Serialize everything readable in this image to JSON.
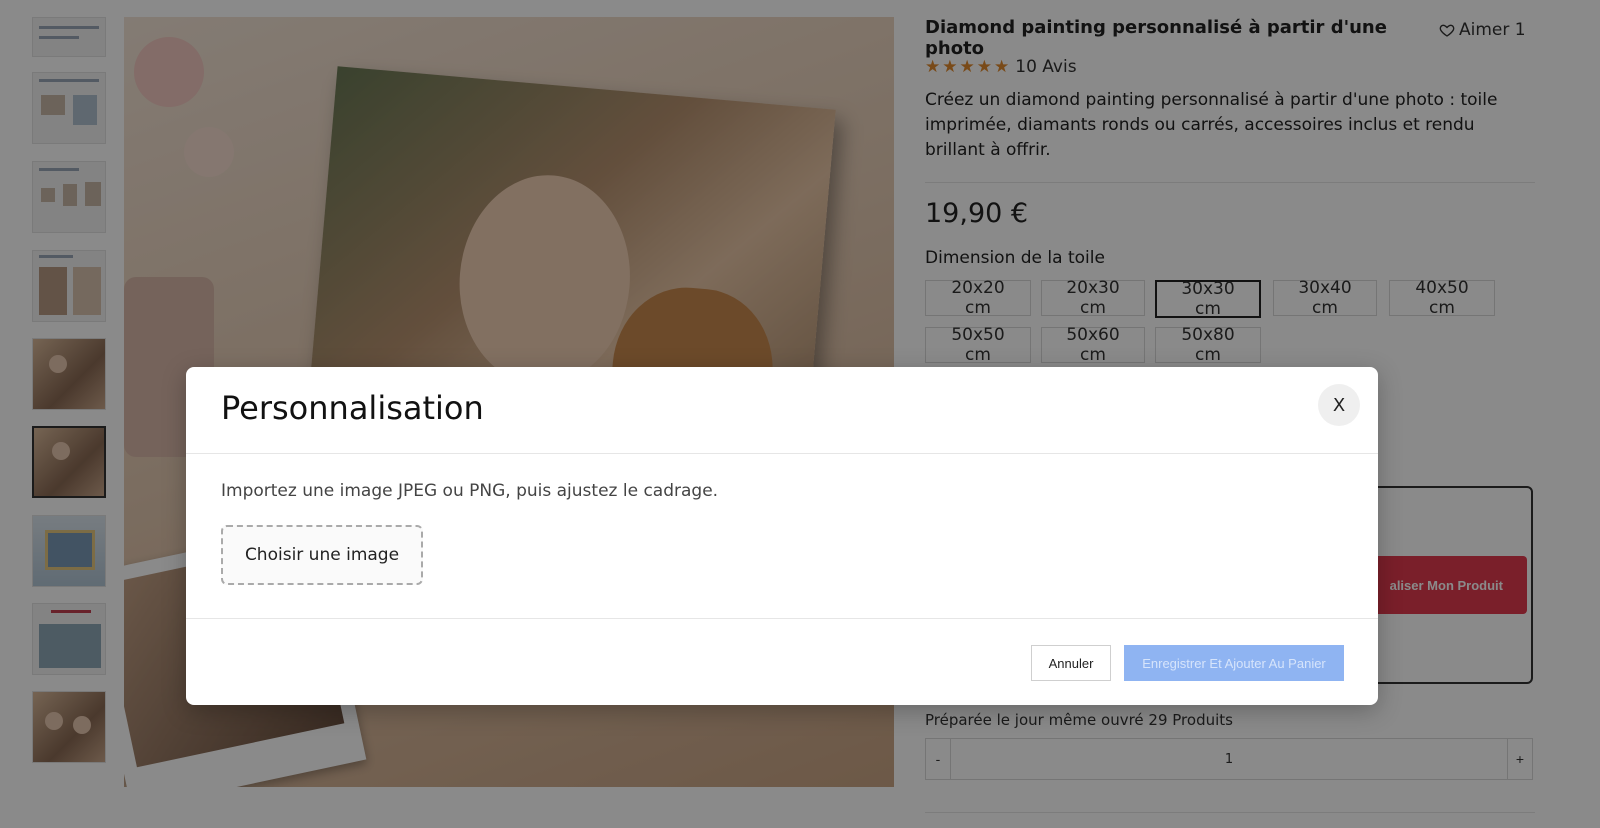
{
  "product": {
    "title": "Diamond painting personnalisé à partir d'une photo",
    "like_label": "Aimer 1",
    "rating_stars": 5,
    "reviews": "10 Avis",
    "description": "Créez un diamond painting personnalisé à partir d'une photo : toile imprimée, diamants ronds ou carrés, accessoires inclus et rendu brillant à offrir.",
    "price": "19,90 €",
    "dimension_label": "Dimension de la toile",
    "sizes": [
      "20x20 cm",
      "20x30 cm",
      "30x30 cm",
      "30x40 cm",
      "40x50 cm",
      "50x50 cm",
      "50x60 cm",
      "50x80 cm"
    ],
    "selected_size": "30x30 cm",
    "customize_button": "aliser Mon Produit",
    "prep_text": "Préparée le jour même ouvré 29 Produits",
    "quantity": {
      "minus": "-",
      "value": "1",
      "plus": "+"
    }
  },
  "modal": {
    "title": "Personnalisation",
    "close_label": "X",
    "hint": "Importez une image JPEG ou PNG, puis ajustez le cadrage.",
    "choose_button": "Choisir une image",
    "cancel_button": "Annuler",
    "save_button": "Enregistrer Et Ajouter Au Panier"
  },
  "colors": {
    "accent_red": "#e23a4f",
    "star": "#e08a2e",
    "save_button_bg": "#8fb4f2"
  }
}
